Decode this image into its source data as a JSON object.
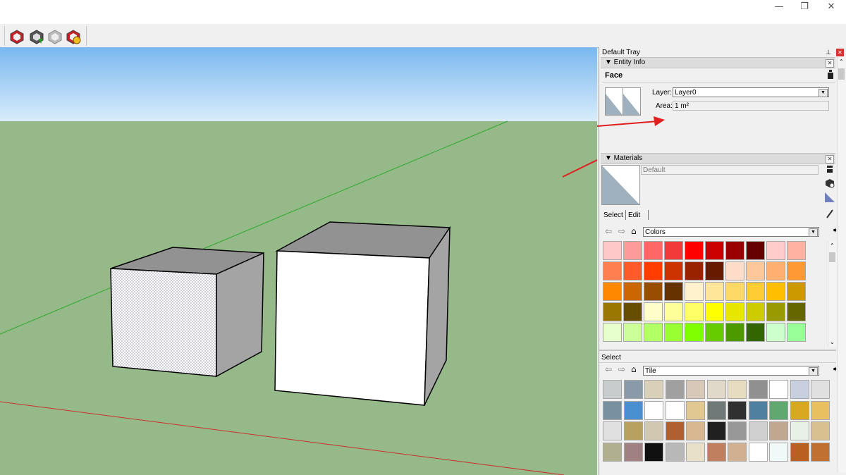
{
  "window": {
    "minimize_glyph": "—",
    "restore_glyph": "❐",
    "close_glyph": "✕"
  },
  "toolbar": {
    "icons": [
      "extension-warehouse-icon",
      "share-component-icon",
      "get-models-icon",
      "extension-manager-icon"
    ]
  },
  "tray": {
    "title": "Default Tray",
    "pin_glyph": "⊥",
    "close_glyph": "✕"
  },
  "entity_info": {
    "header": "▼ Entity Info",
    "entity_type": "Face",
    "layer_label": "Layer:",
    "layer_value": "Layer0",
    "area_label": "Area:",
    "area_value": "1 m²"
  },
  "materials": {
    "header": "▼ Materials",
    "material_name": "Default",
    "tabs": [
      "Select",
      "Edit"
    ],
    "library": "Colors",
    "secondary_label": "Select",
    "secondary_library": "Tile",
    "colors": [
      [
        "#ffc8c8",
        "#ff9a9a",
        "#ff6666",
        "#f33a3a",
        "#ff0000",
        "#cc0000",
        "#990000",
        "#660000",
        "#ffcccc",
        "#ffb3a0"
      ],
      [
        "#ff7f50",
        "#ff5a2a",
        "#ff3d00",
        "#cc3300",
        "#992200",
        "#661a00",
        "#ffdcc8",
        "#ffc89a",
        "#ffb070",
        "#ff9933"
      ],
      [
        "#ff8800",
        "#cc6600",
        "#994d00",
        "#663300",
        "#fff2cc",
        "#ffe699",
        "#ffd966",
        "#ffcc33",
        "#ffbf00",
        "#cc9900"
      ],
      [
        "#997700",
        "#664d00",
        "#ffffcc",
        "#ffff99",
        "#ffff66",
        "#ffff00",
        "#e6e600",
        "#cccc00",
        "#999900",
        "#666600"
      ],
      [
        "#e6ffcc",
        "#ccff99",
        "#b3ff66",
        "#99ff33",
        "#80ff00",
        "#66cc00",
        "#4d9900",
        "#336600",
        "#ccffcc",
        "#99ff99"
      ]
    ],
    "tiles": [
      [
        "#c8cccc",
        "#8a9aa8",
        "#d8d0b8",
        "#a0a0a0",
        "#d8c8b8",
        "#e0d8c8",
        "#e8dcc0",
        "#909090",
        "#ffffff",
        "#c8d0e0",
        "#e0e0e0"
      ],
      [
        "#7890a0",
        "#4a90d0",
        "#ffffff",
        "#ffffff",
        "#e0c890",
        "#707878",
        "#303030",
        "#5080a0",
        "#60a870",
        "#d8a820",
        "#e8c060"
      ],
      [
        "#e0e0e0",
        "#b8a060",
        "#d0c8b0",
        "#b06030",
        "#d8b890",
        "#202020",
        "#989898",
        "#d0d0d0",
        "#c0a890",
        "#e8f0e8",
        "#d8c090"
      ],
      [
        "#b0b090",
        "#a08080",
        "#101010",
        "#b8b8b8",
        "#e8e0c8",
        "#c08060",
        "#d0b090",
        "#ffffff",
        "#f0f8f8",
        "#b86020",
        "#c07030"
      ]
    ]
  }
}
